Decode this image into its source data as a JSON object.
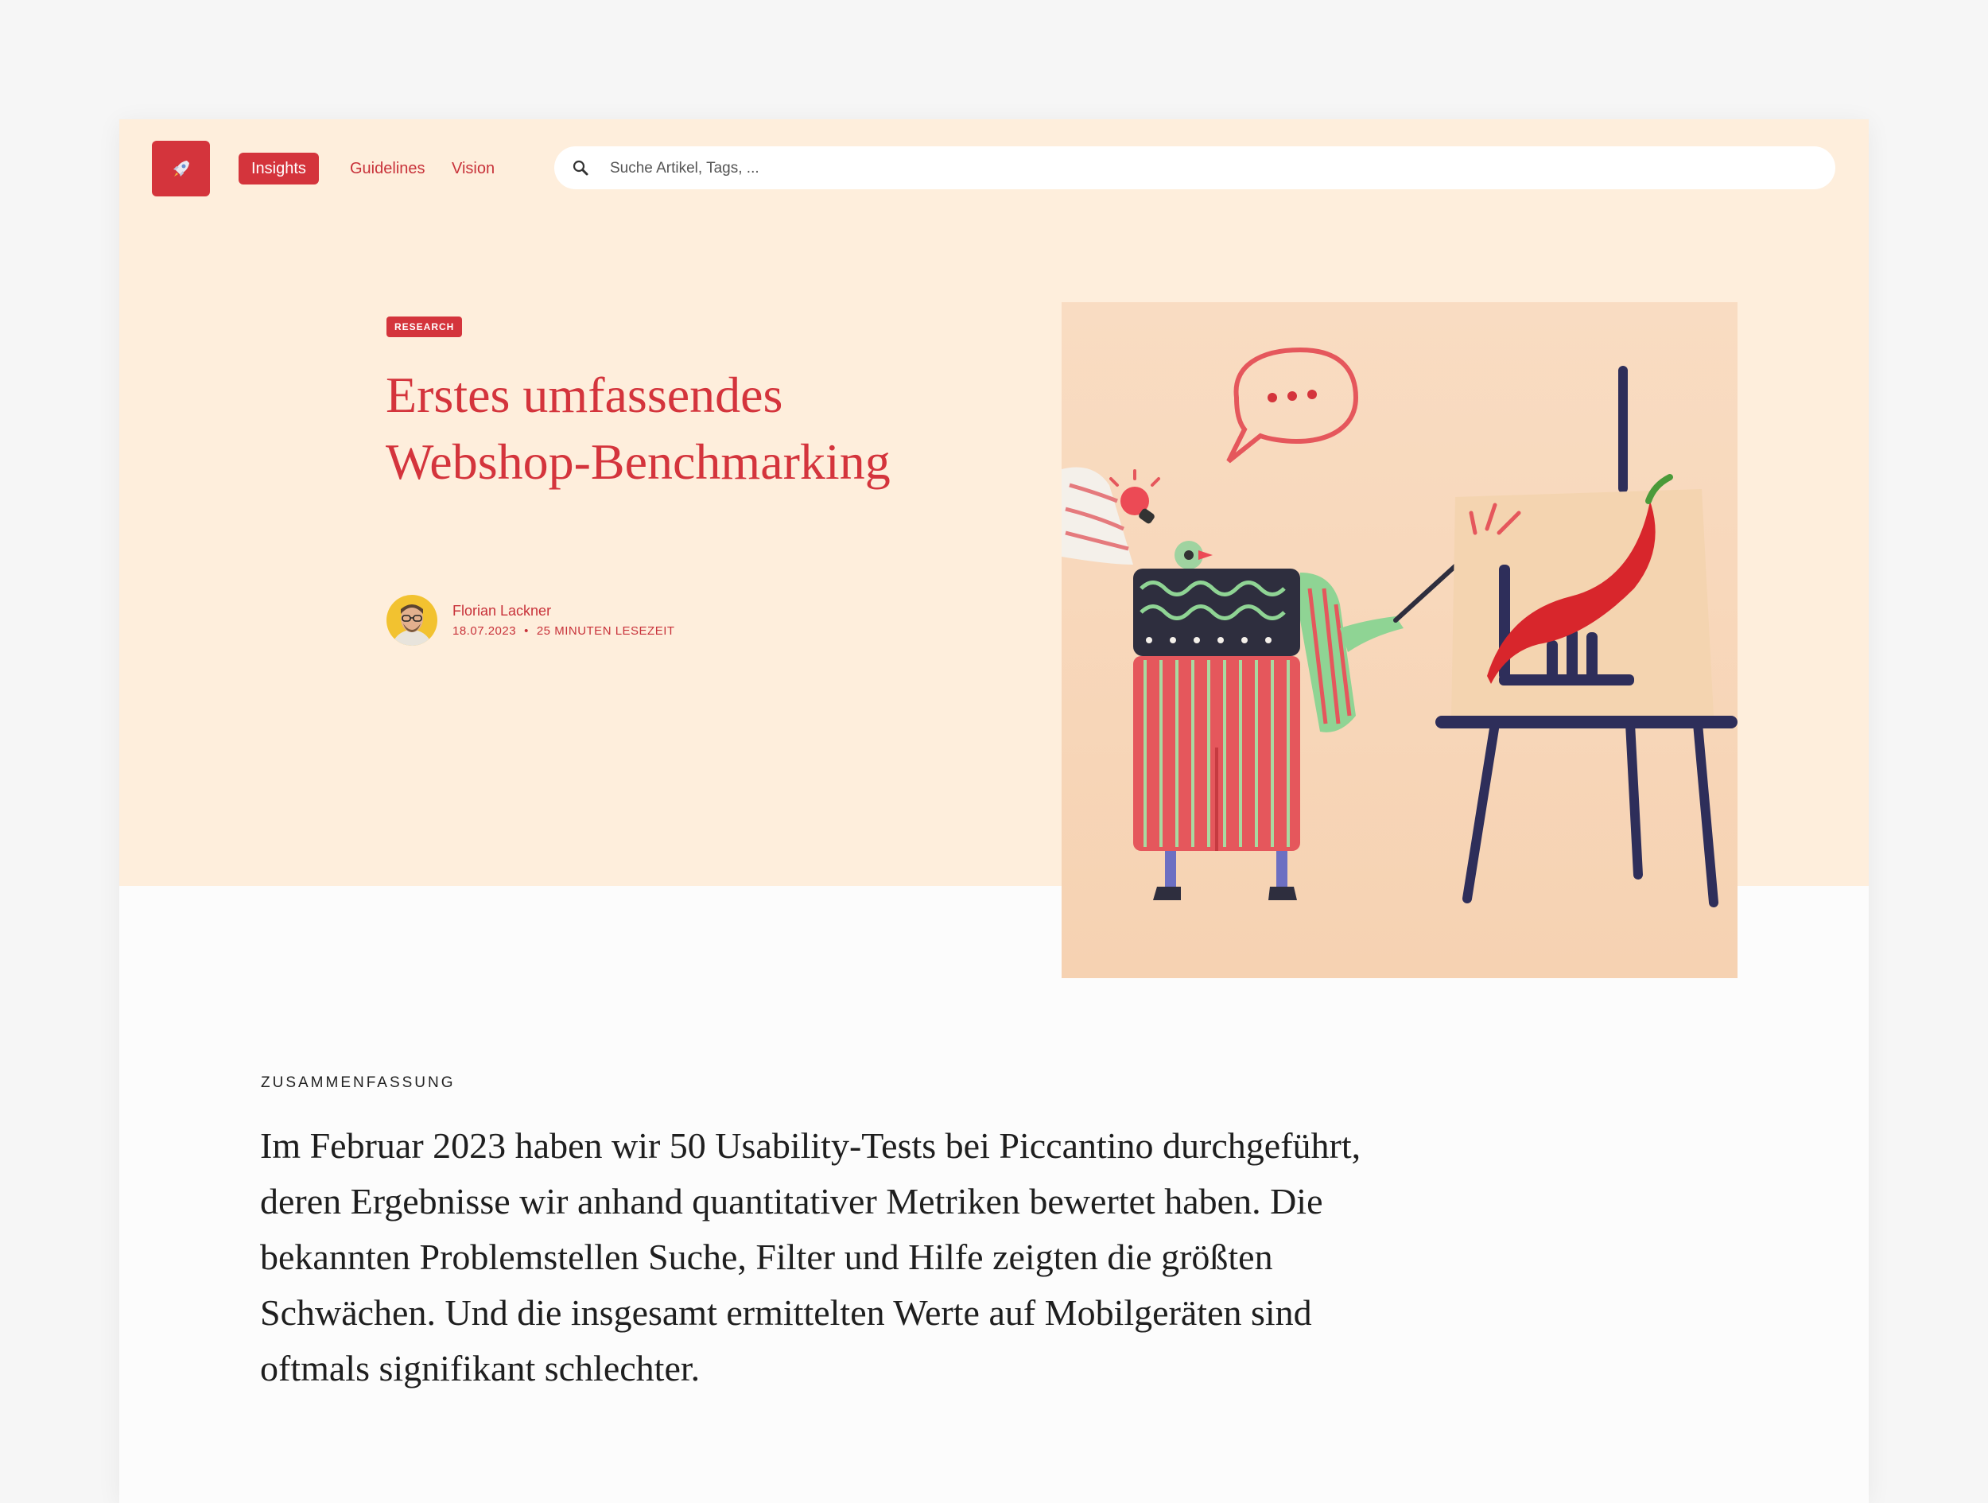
{
  "nav": {
    "logo_icon": "rocket-icon",
    "items": [
      {
        "label": "Insights",
        "active": true
      },
      {
        "label": "Guidelines",
        "active": false
      },
      {
        "label": "Vision",
        "active": false
      }
    ],
    "search": {
      "placeholder": "Suche Artikel, Tags, ...",
      "icon": "search-icon"
    }
  },
  "article": {
    "category": "RESEARCH",
    "title_line1": "Erstes umfassendes",
    "title_line2": "Webshop-Benchmarking",
    "author": "Florian Lackner",
    "date": "18.07.2023",
    "separator": "•",
    "reading_time": "25 MINUTEN LESEZEIT"
  },
  "summary": {
    "label": "ZUSAMMENFASSUNG",
    "text": "Im Februar 2023 haben wir 50 Usability-Tests bei Piccantino durchgeführt, deren Ergebnisse wir anhand quantitativer Metriken bewertet haben. Die bekannten Problemstellen Suche, Filter und Hilfe zeigten die größten Schwächen. Und die insgesamt ermittelten Werte auf Mobilgeräten sind oftmals signifikant schlechter."
  },
  "colors": {
    "accent": "#d4343c",
    "hero_bg": "#feeedc",
    "page_bg": "#fcfcfc"
  }
}
